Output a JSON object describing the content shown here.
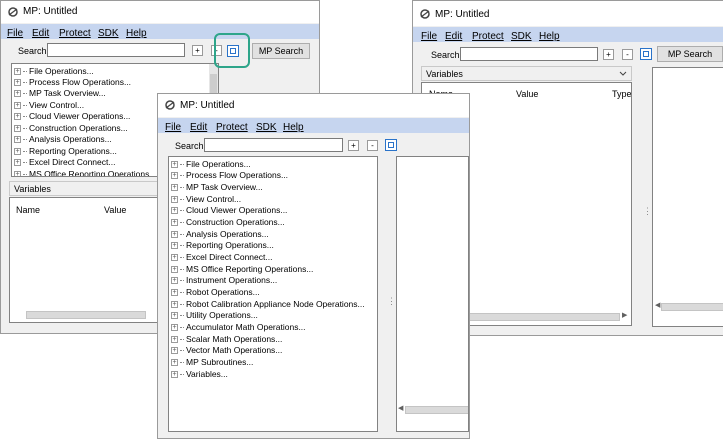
{
  "window_title": "MP: Untitled",
  "menu": {
    "file": "File",
    "edit": "Edit",
    "protect": "Protect",
    "sdk": "SDK",
    "help": "Help"
  },
  "search": {
    "label": "Search:",
    "value": "",
    "expand": "+",
    "collapse": "-",
    "mp_search": "MP Search"
  },
  "variables": {
    "header": "Variables",
    "col_name": "Name",
    "col_value": "Value",
    "col_type": "Type"
  },
  "tree_items": [
    "File Operations...",
    "Process Flow Operations...",
    "MP Task Overview...",
    "View Control...",
    "Cloud Viewer Operations...",
    "Construction Operations...",
    "Analysis Operations...",
    "Reporting Operations...",
    "Excel Direct Connect...",
    "MS Office Reporting Operations...",
    "Instrument Operations...",
    "Robot Operations...",
    "Robot Calibration Appliance Node Operations...",
    "Utility Operations...",
    "Accumulator Math Operations...",
    "Scalar Math Operations...",
    "Vector Math Operations...",
    "MP Subroutines...",
    "Variables..."
  ],
  "colors": {
    "menubar": "#c6d5ef",
    "toggle_border": "#2a73c9",
    "highlight": "#2ea58a"
  }
}
